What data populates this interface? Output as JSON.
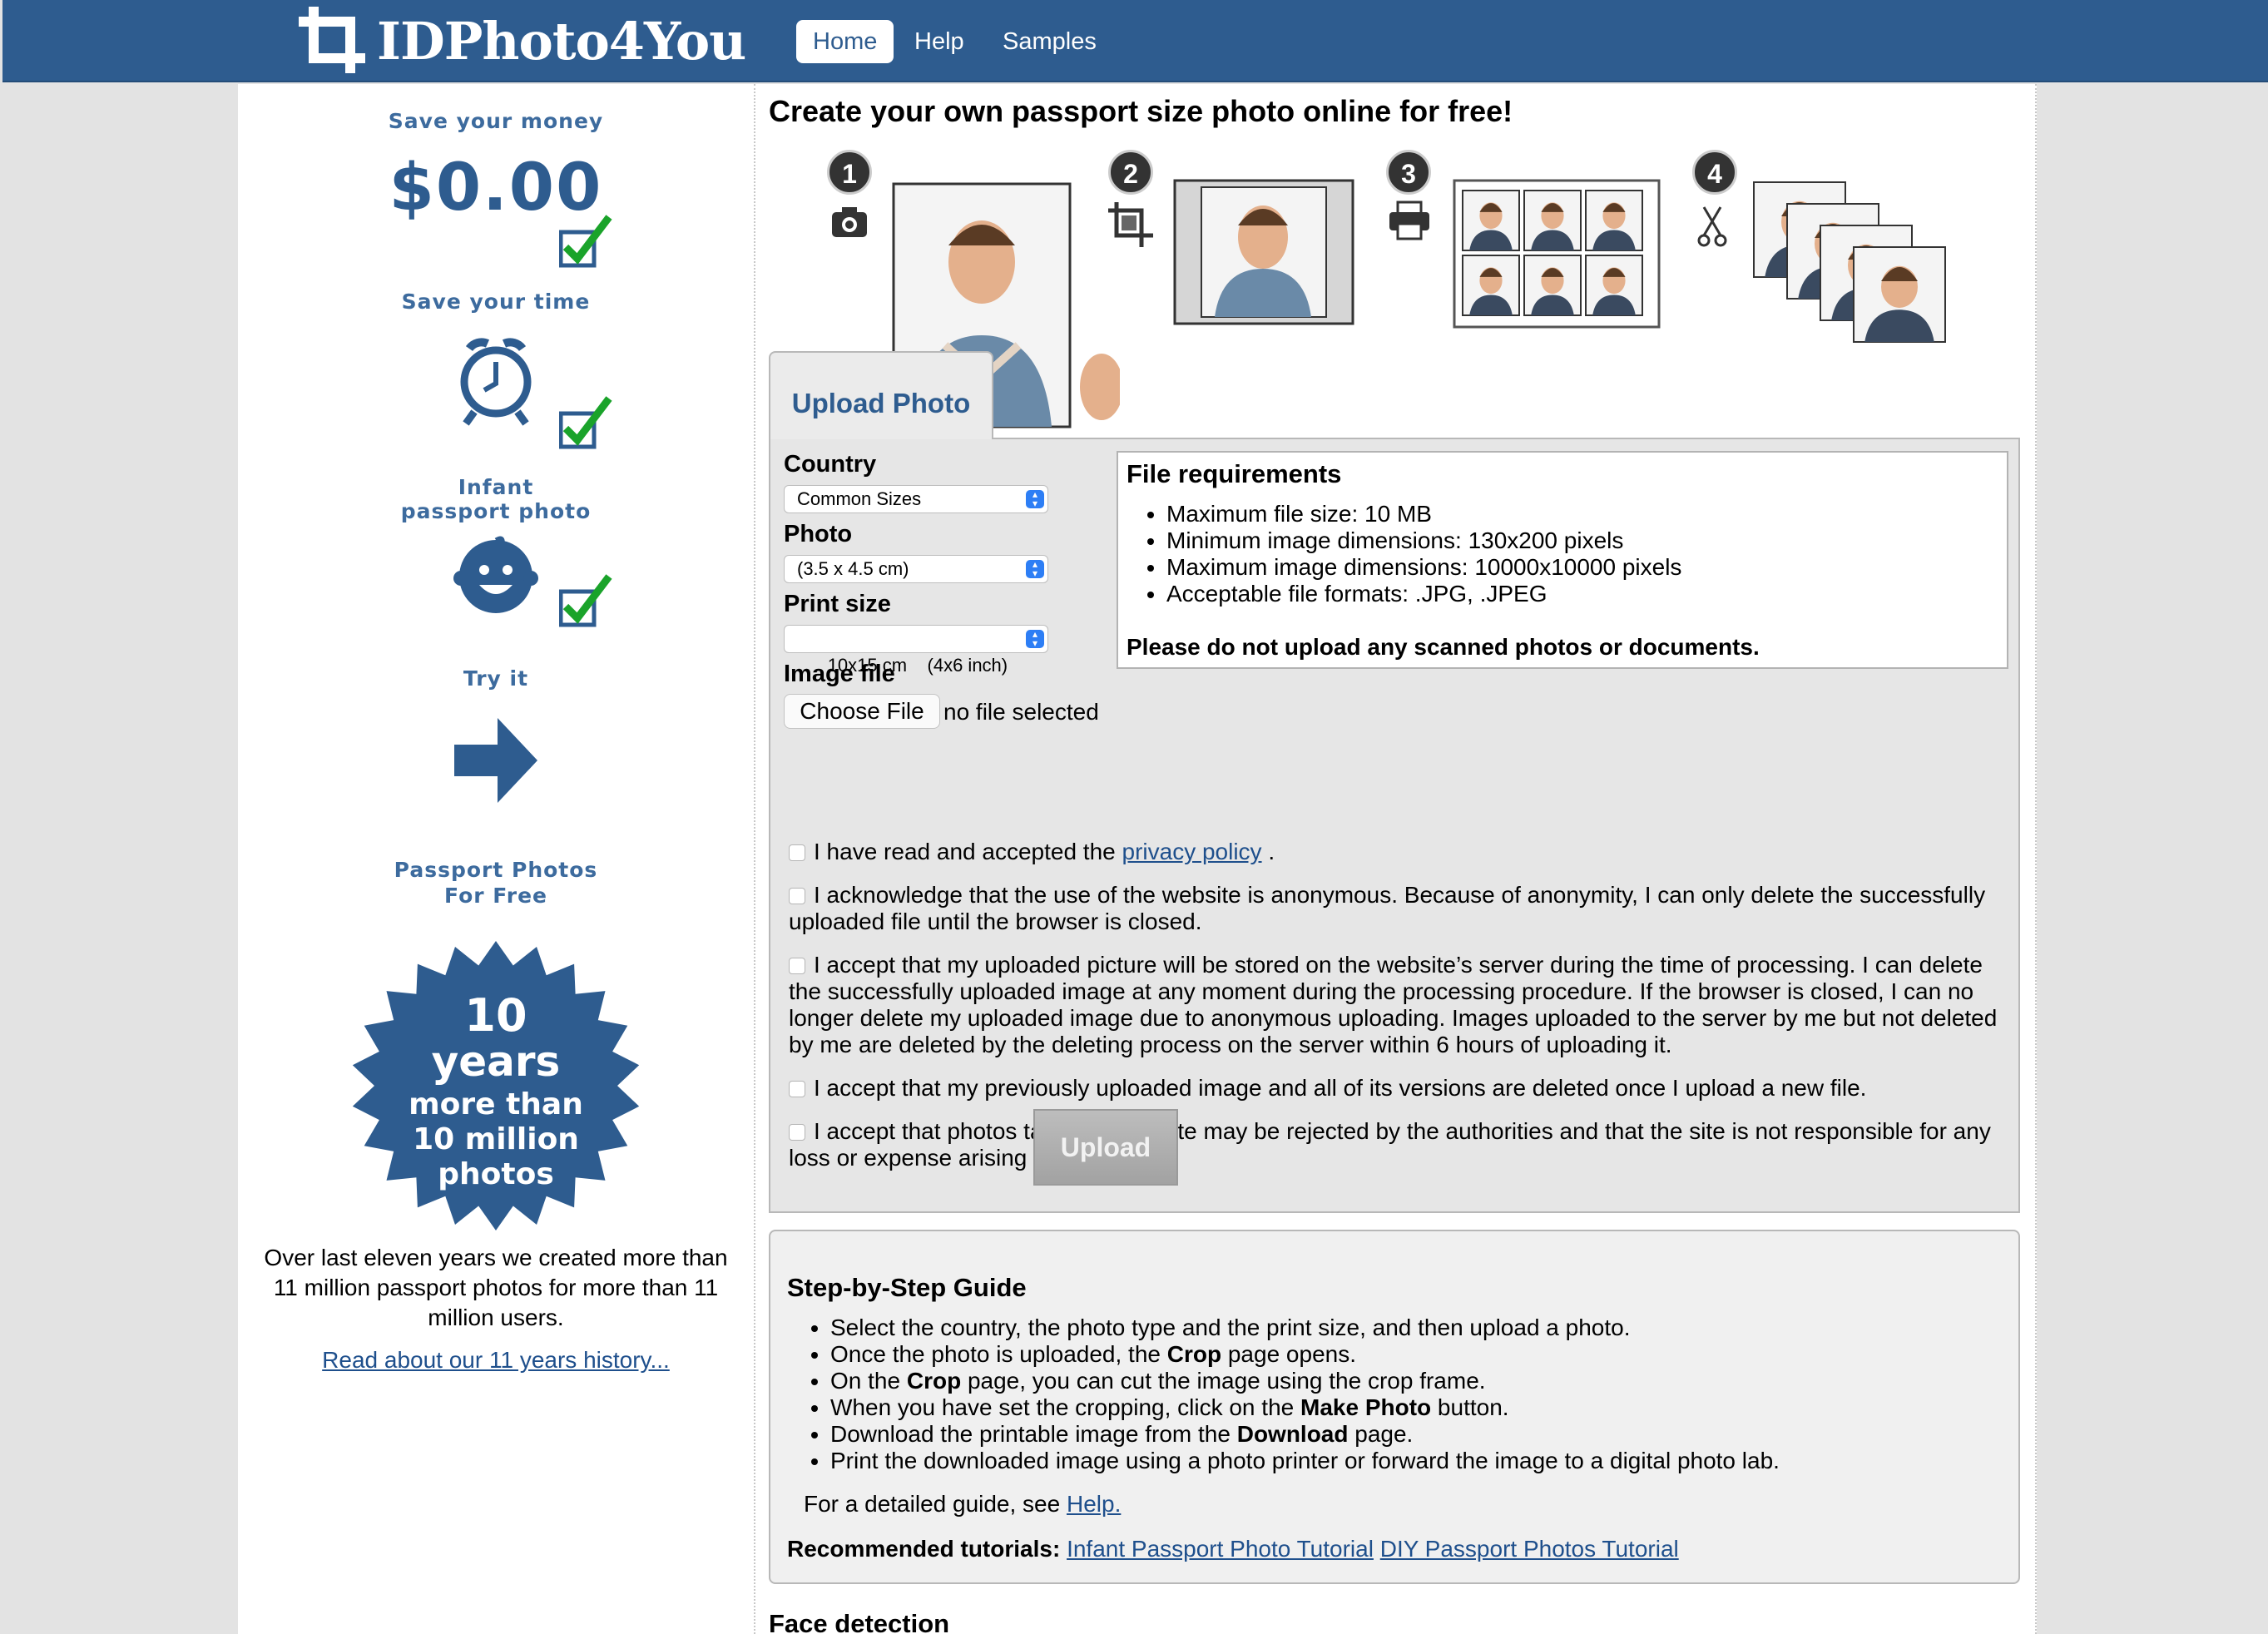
{
  "header": {
    "logo_text": "IDPhoto4You",
    "nav": [
      {
        "label": "Home",
        "active": true
      },
      {
        "label": "Help"
      },
      {
        "label": "Samples"
      }
    ],
    "bg_color": "#2e5c8f"
  },
  "sidebar": {
    "save_money": "Save your money",
    "price": "$0.00",
    "save_time": "Save your time",
    "infant_line1": "Infant",
    "infant_line2": "passport photo",
    "try_it": "Try it",
    "free_line1": "Passport Photos",
    "free_line2": "For Free",
    "badge_line1": "10",
    "badge_line2": "years",
    "badge_line3": "more than",
    "badge_line4": "10 million",
    "badge_line5": "photos",
    "history_text": "Over last eleven years we created more than 11 million passport photos for more than 11 million users.",
    "history_link": "Read about our 11 years history..."
  },
  "main": {
    "title": "Create your own passport size photo online for free!",
    "steps": [
      {
        "num": "1",
        "icon": "camera-icon"
      },
      {
        "num": "2",
        "icon": "crop-icon"
      },
      {
        "num": "3",
        "icon": "printer-icon"
      },
      {
        "num": "4",
        "icon": "scissors-icon"
      }
    ],
    "tab_label": "Upload Photo",
    "form": {
      "country_label": "Country",
      "country_value": "Common Sizes",
      "photo_label": "Photo",
      "photo_value": "(3.5 x 4.5 cm)",
      "print_label": "Print size",
      "print_value": "10x15 cm    (4x6 inch)",
      "image_label": "Image file",
      "choose_file": "Choose File",
      "no_file": "no file selected"
    },
    "requirements": {
      "title": "File requirements",
      "items": [
        "Maximum file size: 10 MB",
        "Minimum image dimensions: 130x200 pixels",
        "Maximum image dimensions: 10000x10000 pixels",
        "Acceptable file formats: .JPG, .JPEG"
      ],
      "note": "Please do not upload any scanned photos or documents."
    },
    "checks": {
      "c1_text": "I have read and accepted the ",
      "c1_link": "privacy policy",
      "c1_end": " .",
      "c2": "I acknowledge that the use of the website is anonymous. Because of anonymity, I can only delete the successfully uploaded file until the browser is closed.",
      "c3": "I accept that my uploaded picture will be stored on the website’s server during the time of processing. I can delete the successfully uploaded image at any moment during the processing procedure. If the browser is closed, I can no longer delete my uploaded image due to anonymous uploading. Images uploaded to the server by me but not deleted by me are deleted by the deleting process on the server within 6 hours of uploading it.",
      "c4": "I accept that my previously uploaded image and all of its versions are deleted once I upload a new file.",
      "c5": "I accept that photos taken by this site may be rejected by the authorities and that the site is not responsible for any loss or expense arising therefrom."
    },
    "upload_label": "Upload",
    "guide": {
      "title": "Step-by-Step Guide",
      "i1": "Select the country, the photo type and the print size, and then upload a photo.",
      "i2a": "Once the photo is uploaded, the ",
      "i2b": "Crop",
      "i2c": " page opens.",
      "i3a": "On the ",
      "i3b": "Crop",
      "i3c": " page, you can cut the image using the crop frame.",
      "i4a": "When you have set the cropping, click on the ",
      "i4b": "Make Photo",
      "i4c": " button.",
      "i5a": "Download the printable image from the ",
      "i5b": "Download",
      "i5c": " page.",
      "i6": "Print the downloaded image using a photo printer or forward the image to a digital photo lab.",
      "help_text": "For a detailed guide, see ",
      "help_link": "Help.",
      "rec_label": "Recommended tutorials:",
      "rec_link1": "Infant Passport Photo Tutorial",
      "rec_link2": "DIY Passport Photos Tutorial"
    },
    "face_title": "Face detection"
  }
}
